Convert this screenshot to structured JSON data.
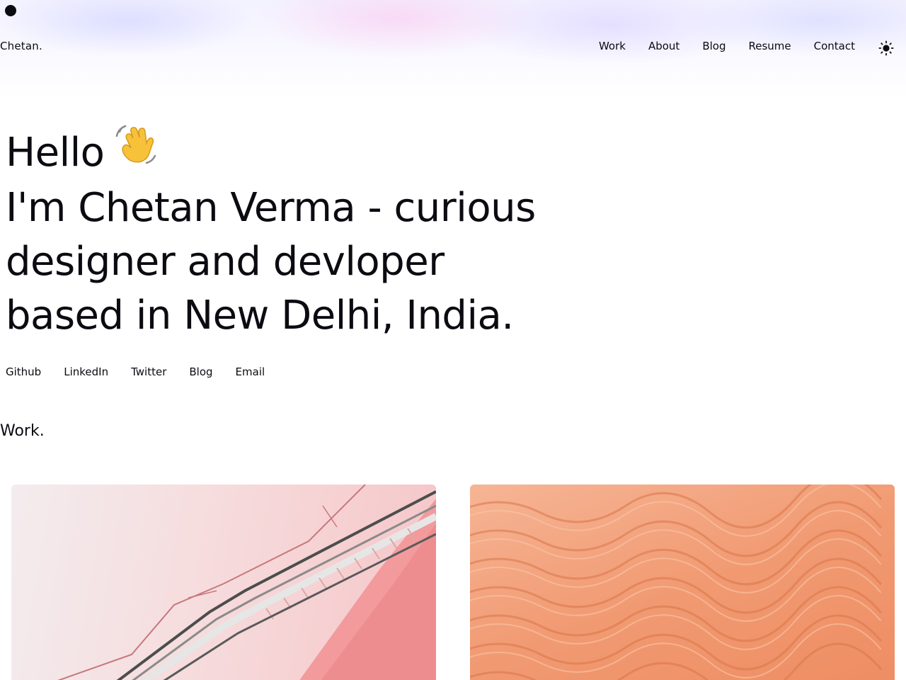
{
  "header": {
    "brand": "Chetan.",
    "nav": [
      {
        "label": "Work"
      },
      {
        "label": "About"
      },
      {
        "label": "Blog"
      },
      {
        "label": "Resume"
      },
      {
        "label": "Contact"
      }
    ],
    "theme_icon": "sun-icon"
  },
  "hero": {
    "line1": "Hello",
    "wave_icon": "waving-hand-icon",
    "line2": "I'm Chetan Verma - curious",
    "line3": "designer and devloper",
    "line4": "based in New Delhi, India."
  },
  "social": [
    {
      "label": "Github"
    },
    {
      "label": "LinkedIn"
    },
    {
      "label": "Twitter"
    },
    {
      "label": "Blog"
    },
    {
      "label": "Email"
    }
  ],
  "work": {
    "title": "Work.",
    "cards": [
      {
        "image": "pink-staircase-photo"
      },
      {
        "image": "orange-sand-dunes-photo"
      }
    ]
  }
}
